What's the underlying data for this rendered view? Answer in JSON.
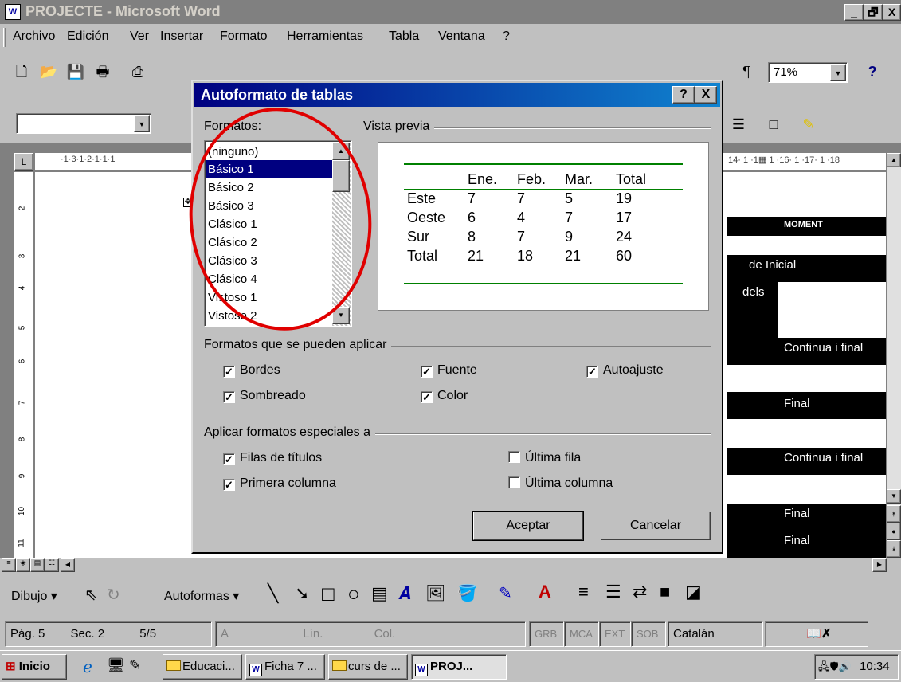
{
  "window": {
    "title": "PROJECTE - Microsoft Word",
    "app_icon": "W",
    "controls": [
      "_",
      "🗗",
      "X"
    ]
  },
  "menubar": {
    "items": [
      "Archivo",
      "Edición",
      "Ver",
      "Insertar",
      "Formato",
      "Herramientas",
      "Tabla",
      "Ventana",
      "?"
    ]
  },
  "toolbar": {
    "zoom": "71%",
    "pilcrow": "¶"
  },
  "ruler": {
    "h_left": "·1·3·1·2·1·1·1",
    "h_right": "14· 1 ·1▦ 1 ·16· 1 ·17· 1 ·18",
    "v_marks": [
      "2",
      "3",
      "4",
      "5",
      "6",
      "7",
      "8",
      "9",
      "10",
      "11"
    ]
  },
  "document": {
    "header_cell": "MOMENT",
    "cells": [
      {
        "text": "de  Inicial"
      },
      {
        "text": "dels"
      },
      {
        "text": "Continua i final"
      },
      {
        "text": "Final"
      },
      {
        "text": "Continua i final"
      },
      {
        "text": "Final"
      },
      {
        "text": "Final"
      }
    ]
  },
  "dialog": {
    "title": "Autoformato de tablas",
    "help_btn": "?",
    "close_btn": "X",
    "formats_label": "Formatos:",
    "formats": [
      "(ninguno)",
      "Básico 1",
      "Básico 2",
      "Básico 3",
      "Clásico 1",
      "Clásico 2",
      "Clásico 3",
      "Clásico 4",
      "Vistoso 1",
      "Vistoso 2"
    ],
    "selected_format": "Básico 1",
    "preview_label": "Vista previa",
    "preview_table": {
      "header": [
        "",
        "Ene.",
        "Feb.",
        "Mar.",
        "Total"
      ],
      "rows": [
        [
          "Este",
          "7",
          "7",
          "5",
          "19"
        ],
        [
          "Oeste",
          "6",
          "4",
          "7",
          "17"
        ],
        [
          "Sur",
          "8",
          "7",
          "9",
          "24"
        ],
        [
          "Total",
          "21",
          "18",
          "21",
          "60"
        ]
      ]
    },
    "apply_group_label": "Formatos que se pueden aplicar",
    "apply_options": [
      {
        "label": "Bordes",
        "checked": true
      },
      {
        "label": "Fuente",
        "checked": true
      },
      {
        "label": "Autoajuste",
        "checked": true
      },
      {
        "label": "Sombreado",
        "checked": true
      },
      {
        "label": "Color",
        "checked": true
      }
    ],
    "special_group_label": "Aplicar formatos especiales a",
    "special_options": [
      {
        "label": "Filas de títulos",
        "checked": true
      },
      {
        "label": "Última fila",
        "checked": false
      },
      {
        "label": "Primera columna",
        "checked": true
      },
      {
        "label": "Última columna",
        "checked": false
      }
    ],
    "ok_label": "Aceptar",
    "cancel_label": "Cancelar"
  },
  "drawbar": {
    "draw_label": "Dibujo ▾",
    "autoshapes_label": "Autoformas ▾"
  },
  "statusbar": {
    "page": "Pág. 5",
    "section": "Sec. 2",
    "pages": "5/5",
    "at": "A",
    "line": "Lín.",
    "col": "Col.",
    "grb": "GRB",
    "mca": "MCA",
    "ext": "EXT",
    "sob": "SOB",
    "language": "Catalán"
  },
  "taskbar": {
    "start_label": "Inicio",
    "tasks": [
      "Educaci...",
      "Ficha 7 ...",
      "curs de ...",
      "PROJ..."
    ],
    "clock": "10:34"
  },
  "colors": {
    "title_active": "#000080",
    "selection": "#000080",
    "annotation": "#e00000",
    "preview_rule": "#008000"
  }
}
